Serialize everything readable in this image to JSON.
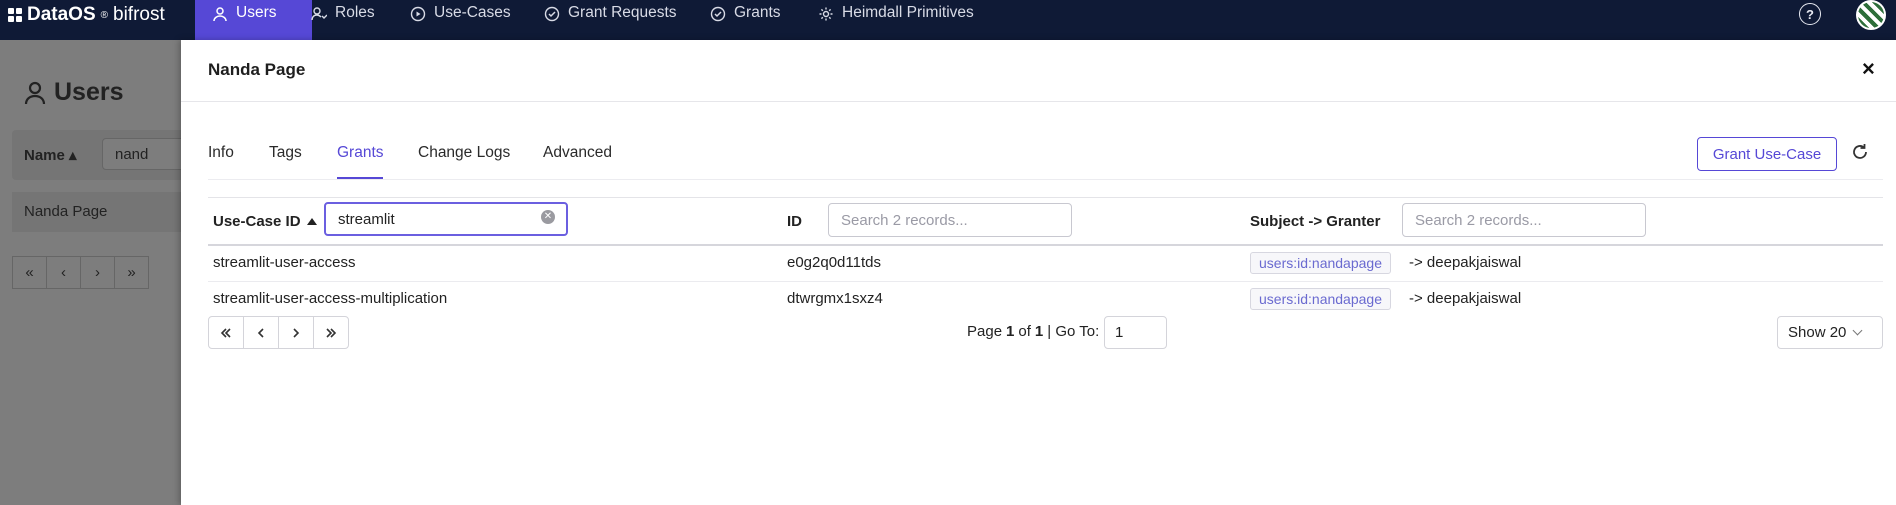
{
  "brand": {
    "name": "DataOS",
    "reg": "®",
    "product": "bifrost"
  },
  "nav": {
    "items": [
      {
        "label": "Users",
        "icon": "user-icon"
      },
      {
        "label": "Roles",
        "icon": "roles-icon"
      },
      {
        "label": "Use-Cases",
        "icon": "play-circle-icon"
      },
      {
        "label": "Grant Requests",
        "icon": "check-circle-icon"
      },
      {
        "label": "Grants",
        "icon": "check-circle-icon"
      },
      {
        "label": "Heimdall Primitives",
        "icon": "gear-icon"
      }
    ],
    "active": "Users",
    "help": "?"
  },
  "background": {
    "title": "Users",
    "filter_label": "Name",
    "filter_value": "nand",
    "row": "Nanda Page",
    "pager": [
      "«",
      "‹",
      "›",
      "»"
    ]
  },
  "modal": {
    "title": "Nanda Page",
    "close": "×",
    "tabs": [
      "Info",
      "Tags",
      "Grants",
      "Change Logs",
      "Advanced"
    ],
    "active_tab": "Grants",
    "grant_button": "Grant Use-Case",
    "table": {
      "columns": [
        {
          "label": "Use-Case ID",
          "filter_value": "streamlit",
          "sorted": "asc"
        },
        {
          "label": "ID",
          "filter_placeholder": "Search 2 records..."
        },
        {
          "label": "Subject -> Granter",
          "filter_placeholder": "Search 2 records..."
        }
      ],
      "rows": [
        {
          "use_case": "streamlit-user-access",
          "id": "e0g2q0d11tds",
          "subject": "users:id:nandapage",
          "granter": "-> deepakjaiswal"
        },
        {
          "use_case": "streamlit-user-access-multiplication",
          "id": "dtwrgmx1sxz4",
          "subject": "users:id:nandapage",
          "granter": "-> deepakjaiswal"
        }
      ]
    },
    "pagination": {
      "page_prefix": "Page",
      "page": "1",
      "of": "of",
      "total": "1",
      "goto_label": "| Go To:",
      "goto_value": "1",
      "show": "Show 20"
    }
  },
  "colors": {
    "nav_bg": "#0f1a36",
    "accent": "#5648d6"
  }
}
